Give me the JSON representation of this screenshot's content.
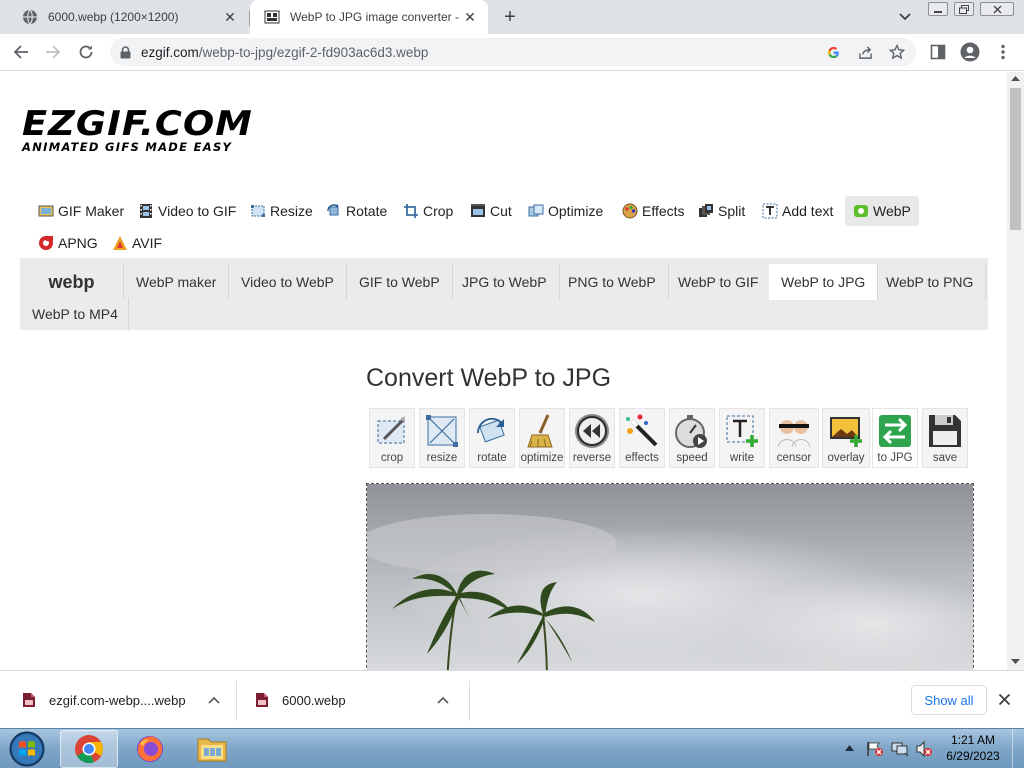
{
  "browser": {
    "tabs": [
      {
        "title": "6000.webp (1200×1200)",
        "active": false
      },
      {
        "title": "WebP to JPG image converter - E",
        "active": true
      }
    ],
    "new_tab_label": "+",
    "url_host": "ezgif.com",
    "url_path": "/webp-to-jpg/ezgif-2-fd903ac6d3.webp"
  },
  "site": {
    "logo_text": "EZGIF.COM",
    "logo_tagline": "ANIMATED GIFS MADE EASY",
    "main_nav": [
      {
        "label": "GIF Maker",
        "icon": "gif-maker-icon"
      },
      {
        "label": "Video to GIF",
        "icon": "film-icon"
      },
      {
        "label": "Resize",
        "icon": "resize-icon"
      },
      {
        "label": "Rotate",
        "icon": "rotate-icon"
      },
      {
        "label": "Crop",
        "icon": "crop-icon"
      },
      {
        "label": "Cut",
        "icon": "cut-icon"
      },
      {
        "label": "Optimize",
        "icon": "optimize-icon"
      },
      {
        "label": "Effects",
        "icon": "effects-icon"
      },
      {
        "label": "Split",
        "icon": "split-icon"
      },
      {
        "label": "Add text",
        "icon": "text-icon"
      },
      {
        "label": "WebP",
        "icon": "webp-icon",
        "active": true
      },
      {
        "label": "APNG",
        "icon": "apng-icon"
      },
      {
        "label": "AVIF",
        "icon": "avif-icon"
      }
    ],
    "sub_nav_logo": "webp",
    "sub_nav": [
      {
        "label": "WebP maker"
      },
      {
        "label": "Video to WebP"
      },
      {
        "label": "GIF to WebP"
      },
      {
        "label": "JPG to WebP"
      },
      {
        "label": "PNG to WebP"
      },
      {
        "label": "WebP to GIF"
      },
      {
        "label": "WebP to JPG",
        "active": true
      },
      {
        "label": "WebP to PNG"
      },
      {
        "label": "WebP to MP4"
      }
    ],
    "page_title": "Convert WebP to JPG",
    "tools": [
      {
        "label": "crop",
        "icon": "crop-tool-icon"
      },
      {
        "label": "resize",
        "icon": "resize-tool-icon"
      },
      {
        "label": "rotate",
        "icon": "rotate-tool-icon"
      },
      {
        "label": "optimize",
        "icon": "broom-icon"
      },
      {
        "label": "reverse",
        "icon": "reverse-icon"
      },
      {
        "label": "effects",
        "icon": "magic-wand-icon"
      },
      {
        "label": "speed",
        "icon": "stopwatch-icon"
      },
      {
        "label": "write",
        "icon": "write-text-icon"
      },
      {
        "label": "censor",
        "icon": "censor-icon"
      },
      {
        "label": "overlay",
        "icon": "overlay-icon"
      },
      {
        "label": "to JPG",
        "icon": "convert-arrows-icon",
        "active": true
      },
      {
        "label": "save",
        "icon": "floppy-disk-icon"
      }
    ]
  },
  "downloads": {
    "items": [
      {
        "name": "ezgif.com-webp....webp"
      },
      {
        "name": "6000.webp"
      }
    ],
    "show_all": "Show all"
  },
  "taskbar": {
    "time": "1:21 AM",
    "date": "6/29/2023"
  },
  "colors": {
    "tab_strip": "#dee1e6",
    "omnibox": "#f1f3f4",
    "link_blue": "#1a73e8",
    "subnav_bg": "#ebebeb",
    "taskbar": "#7ea6c8"
  }
}
